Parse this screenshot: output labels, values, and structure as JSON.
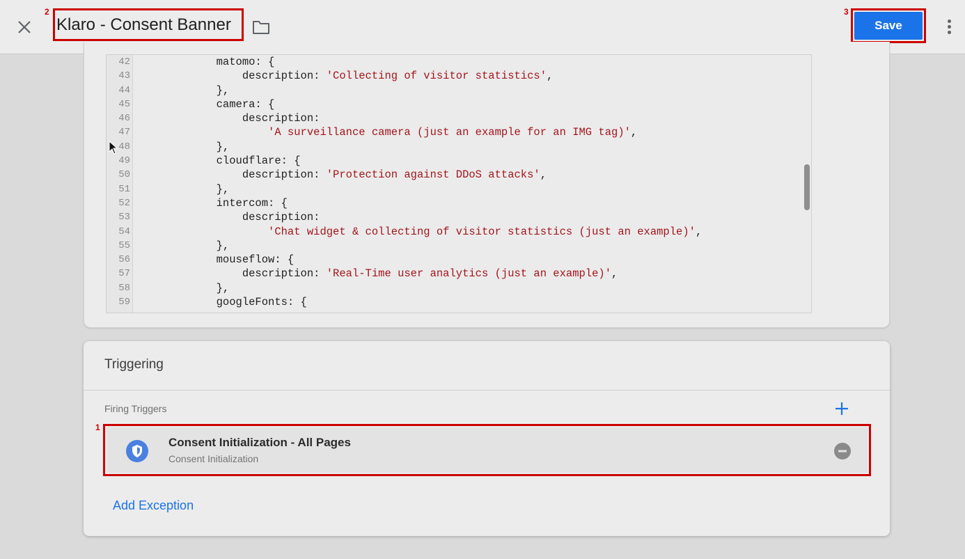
{
  "header": {
    "title": "Klaro - Consent Banner",
    "save_label": "Save"
  },
  "annotations": [
    "1",
    "2",
    "3"
  ],
  "editor": {
    "lines": [
      {
        "n": "42",
        "code": "            matomo: {",
        "str": ""
      },
      {
        "n": "43",
        "code": "                description: ",
        "str": "'Collecting of visitor statistics'",
        "tail": ","
      },
      {
        "n": "44",
        "code": "            },",
        "str": ""
      },
      {
        "n": "45",
        "code": "            camera: {",
        "str": ""
      },
      {
        "n": "46",
        "code": "                description:",
        "str": ""
      },
      {
        "n": "47",
        "code": "                    ",
        "str": "'A surveillance camera (just an example for an IMG tag)'",
        "tail": ","
      },
      {
        "n": "48",
        "code": "            },",
        "str": ""
      },
      {
        "n": "49",
        "code": "            cloudflare: {",
        "str": ""
      },
      {
        "n": "50",
        "code": "                description: ",
        "str": "'Protection against DDoS attacks'",
        "tail": ","
      },
      {
        "n": "51",
        "code": "            },",
        "str": ""
      },
      {
        "n": "52",
        "code": "            intercom: {",
        "str": ""
      },
      {
        "n": "53",
        "code": "                description:",
        "str": ""
      },
      {
        "n": "54",
        "code": "                    ",
        "str": "'Chat widget & collecting of visitor statistics (just an example)'",
        "tail": ","
      },
      {
        "n": "55",
        "code": "            },",
        "str": ""
      },
      {
        "n": "56",
        "code": "            mouseflow: {",
        "str": ""
      },
      {
        "n": "57",
        "code": "                description: ",
        "str": "'Real-Time user analytics (just an example)'",
        "tail": ","
      },
      {
        "n": "58",
        "code": "            },",
        "str": ""
      },
      {
        "n": "59",
        "code": "            googleFonts: {",
        "str": ""
      }
    ]
  },
  "triggering": {
    "heading": "Triggering",
    "firing_label": "Firing Triggers",
    "trigger": {
      "name": "Consent Initialization - All Pages",
      "type": "Consent Initialization"
    },
    "add_exception": "Add Exception"
  },
  "colors": {
    "accent": "#1a73e8",
    "highlight": "#cc0000",
    "string": "#a3151c"
  },
  "icons": {
    "close": "close-icon",
    "folder": "folder-icon",
    "more": "more-vert-icon",
    "add": "plus-icon",
    "trigger": "shield-icon",
    "remove": "remove-circle-icon"
  }
}
